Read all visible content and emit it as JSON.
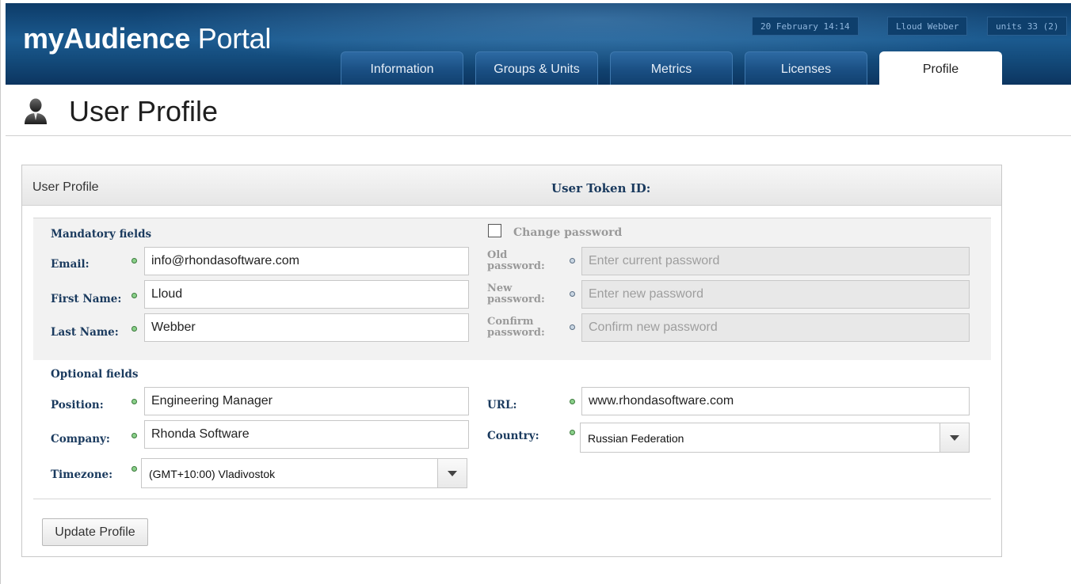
{
  "app": {
    "logo_bold": "myAudience",
    "logo_light": "Portal"
  },
  "header": {
    "date": "20 February 14:14",
    "user": "Lloud Webber",
    "units": "units 33 (2)"
  },
  "tabs": [
    {
      "label": "Information",
      "active": false
    },
    {
      "label": "Groups & Units",
      "active": false
    },
    {
      "label": "Metrics",
      "active": false
    },
    {
      "label": "Licenses",
      "active": false
    },
    {
      "label": "Profile",
      "active": true
    }
  ],
  "page": {
    "title": "User Profile"
  },
  "panel": {
    "title": "User Profile",
    "token_label": "User Token ID:",
    "mandatory": {
      "heading": "Mandatory fields",
      "email_label": "Email:",
      "email_value": "info@rhondasoftware.com",
      "first_name_label": "First Name:",
      "first_name_value": "Lloud",
      "last_name_label": "Last Name:",
      "last_name_value": "Webber"
    },
    "password": {
      "change_label": "Change password",
      "checked": false,
      "old_label_1": "Old",
      "old_label_2": "password:",
      "old_placeholder": "Enter current password",
      "new_label_1": "New",
      "new_label_2": "password:",
      "new_placeholder": "Enter new password",
      "confirm_label_1": "Confirm",
      "confirm_label_2": "password:",
      "confirm_placeholder": "Confirm new password"
    },
    "optional": {
      "heading": "Optional fields",
      "position_label": "Position:",
      "position_value": "Engineering Manager",
      "company_label": "Company:",
      "company_value": "Rhonda Software",
      "timezone_label": "Timezone:",
      "timezone_value": "(GMT+10:00) Vladivostok",
      "url_label": "URL:",
      "url_value": "www.rhondasoftware.com",
      "country_label": "Country:",
      "country_value": "Russian Federation"
    },
    "update_button": "Update Profile"
  },
  "colors": {
    "header_blue": "#1b5a8f",
    "label_navy": "#1a3a5e",
    "valid_dot_green": "#8ad08a"
  },
  "icons": {
    "user": "user-silhouette-icon",
    "dropdown": "chevron-down-icon",
    "valid": "status-dot-icon"
  }
}
